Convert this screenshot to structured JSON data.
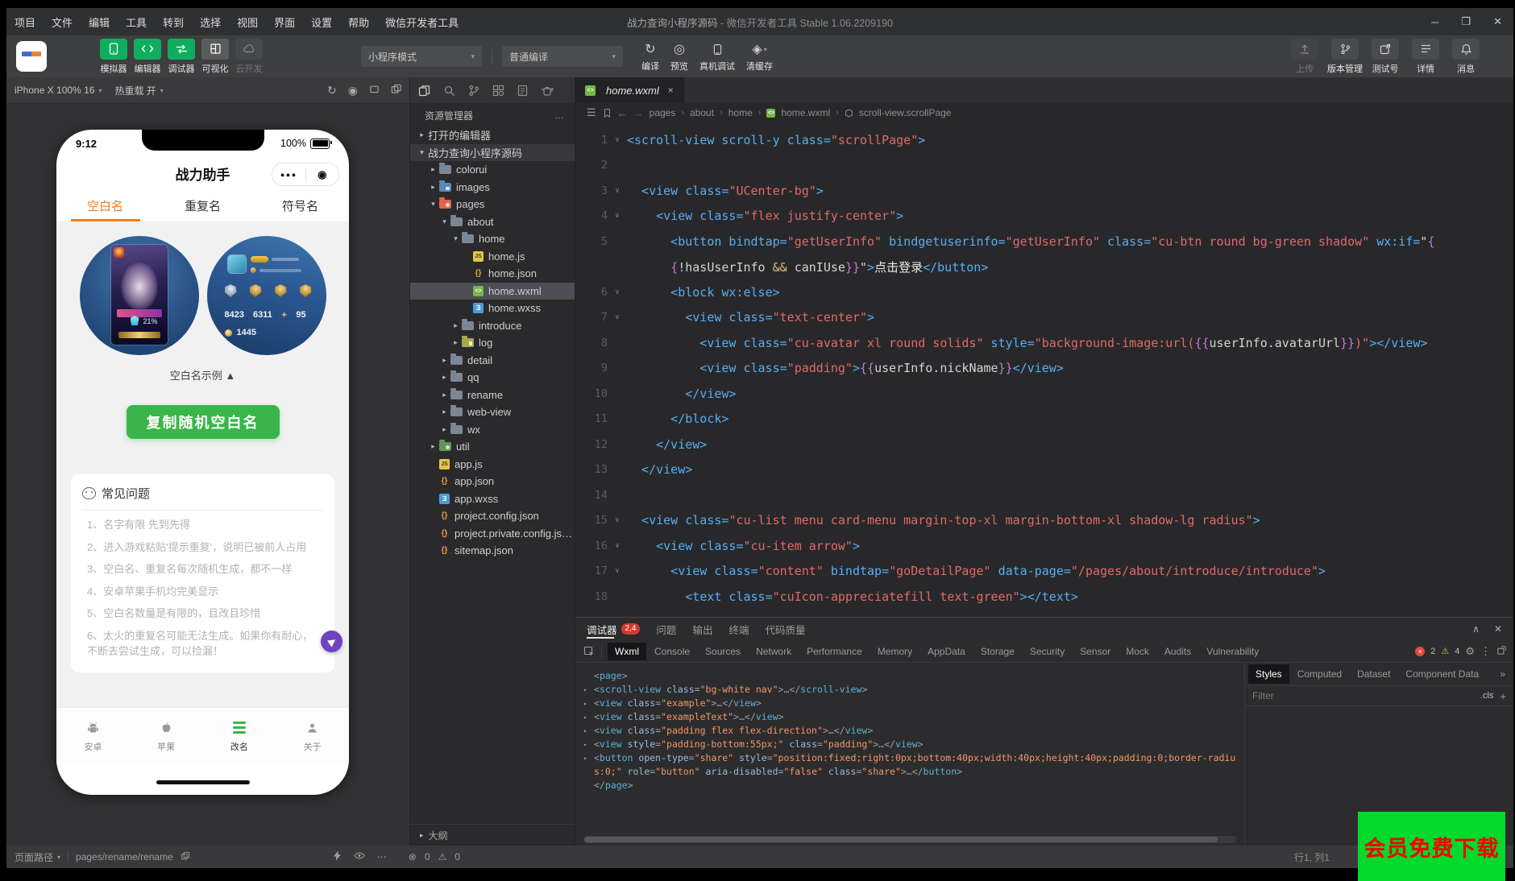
{
  "window": {
    "title_project": "战力查询小程序源码",
    "title_rest": " - 微信开发者工具 Stable 1.06.2209190"
  },
  "menu": {
    "items": [
      "项目",
      "文件",
      "编辑",
      "工具",
      "转到",
      "选择",
      "视图",
      "界面",
      "设置",
      "帮助",
      "微信开发者工具"
    ]
  },
  "toolbar": {
    "primary": [
      {
        "label": "模拟器",
        "icon": "simulator",
        "style": "green"
      },
      {
        "label": "编辑器",
        "icon": "editor",
        "style": "green"
      },
      {
        "label": "调试器",
        "icon": "debugger",
        "style": "green"
      },
      {
        "label": "可视化",
        "icon": "visual",
        "style": "gray"
      },
      {
        "label": "云开发",
        "icon": "cloud",
        "style": "disabled"
      }
    ],
    "mode_dropdown": "小程序模式",
    "compile_dropdown": "普通编译",
    "actions": [
      {
        "label": "编译",
        "icon": "compile"
      },
      {
        "label": "预览",
        "icon": "preview"
      },
      {
        "label": "真机调试",
        "icon": "remote-debug"
      },
      {
        "label": "清缓存",
        "icon": "clear-cache",
        "dropdown": true
      }
    ],
    "right": [
      {
        "label": "上传",
        "icon": "upload",
        "disabled": true
      },
      {
        "label": "版本管理",
        "icon": "version"
      },
      {
        "label": "测试号",
        "icon": "test-account"
      },
      {
        "label": "详情",
        "icon": "details"
      },
      {
        "label": "消息",
        "icon": "message"
      }
    ]
  },
  "simulator": {
    "device": "iPhone X 100% 16",
    "hot_reload": "热重载 开"
  },
  "phone": {
    "time": "9:12",
    "battery": "100%",
    "nav_title": "战力助手",
    "tabs": [
      {
        "label": "空白名",
        "active": true
      },
      {
        "label": "重复名",
        "active": false
      },
      {
        "label": "符号名",
        "active": false
      }
    ],
    "avatar_pct": "21%",
    "stats": [
      "8423",
      "6311",
      "95"
    ],
    "stat_extra": "1445",
    "caption": "空白名示例 ▲",
    "copy_button": "复制随机空白名",
    "faq_title": "常见问题",
    "faq_items": [
      "1、名字有限 先到先得",
      "2、进入游戏粘贴'提示重复'，说明已被前人占用",
      "3、空白名、重复名每次随机生成，都不一样",
      "4、安卓苹果手机均完美显示",
      "5、空白名数量是有限的，且改且珍惜",
      "6、太火的重复名可能无法生成。如果你有耐心，不断去尝试生成，可以捡漏！"
    ],
    "tabbar": [
      {
        "label": "安卓",
        "icon": "android",
        "active": false
      },
      {
        "label": "苹果",
        "icon": "apple",
        "active": false
      },
      {
        "label": "改名",
        "icon": "rename",
        "active": true
      },
      {
        "label": "关于",
        "icon": "about",
        "active": false
      }
    ]
  },
  "explorer": {
    "title": "资源管理器",
    "more": "…",
    "outline": "大纲",
    "tree": [
      {
        "t": "打开的编辑器",
        "d": 0,
        "a": "c"
      },
      {
        "t": "战力查询小程序源码",
        "d": 0,
        "a": "o",
        "row": "proj"
      },
      {
        "t": "colorui",
        "d": 1,
        "a": "c",
        "i": "folder"
      },
      {
        "t": "images",
        "d": 1,
        "a": "c",
        "i": "folder-img"
      },
      {
        "t": "pages",
        "d": 1,
        "a": "o",
        "i": "folder-pages"
      },
      {
        "t": "about",
        "d": 2,
        "a": "o",
        "i": "folder-open"
      },
      {
        "t": "home",
        "d": 3,
        "a": "o",
        "i": "folder-open"
      },
      {
        "t": "home.js",
        "d": 4,
        "i": "js"
      },
      {
        "t": "home.json",
        "d": 4,
        "i": "json"
      },
      {
        "t": "home.wxml",
        "d": 4,
        "i": "wxml",
        "row": "sel"
      },
      {
        "t": "home.wxss",
        "d": 4,
        "i": "wxss"
      },
      {
        "t": "introduce",
        "d": 3,
        "a": "c",
        "i": "folder"
      },
      {
        "t": "log",
        "d": 3,
        "a": "c",
        "i": "folder-log"
      },
      {
        "t": "detail",
        "d": 2,
        "a": "c",
        "i": "folder"
      },
      {
        "t": "qq",
        "d": 2,
        "a": "c",
        "i": "folder"
      },
      {
        "t": "rename",
        "d": 2,
        "a": "c",
        "i": "folder"
      },
      {
        "t": "web-view",
        "d": 2,
        "a": "c",
        "i": "folder"
      },
      {
        "t": "wx",
        "d": 2,
        "a": "c",
        "i": "folder"
      },
      {
        "t": "util",
        "d": 1,
        "a": "c",
        "i": "folder-util"
      },
      {
        "t": "app.js",
        "d": 1,
        "i": "js"
      },
      {
        "t": "app.json",
        "d": 1,
        "i": "json"
      },
      {
        "t": "app.wxss",
        "d": 1,
        "i": "wxss"
      },
      {
        "t": "project.config.json",
        "d": 1,
        "i": "json"
      },
      {
        "t": "project.private.config.js…",
        "d": 1,
        "i": "json"
      },
      {
        "t": "sitemap.json",
        "d": 1,
        "i": "json"
      }
    ]
  },
  "editor": {
    "tab": "home.wxml",
    "breadcrumb": [
      "pages",
      "about",
      "home",
      "home.wxml",
      "scroll-view.scrollPage"
    ],
    "code": [
      {
        "n": "1",
        "f": 1,
        "p": [
          [
            "tg",
            "<scroll-view scroll-y class="
          ],
          [
            "st",
            "\"scrollPage\""
          ],
          [
            "tg",
            ">"
          ]
        ]
      },
      {
        "n": "2",
        "p": []
      },
      {
        "n": "3",
        "f": 1,
        "p": [
          [
            "tg",
            "  <view class="
          ],
          [
            "st",
            "\"UCenter-bg\""
          ],
          [
            "tg",
            ">"
          ]
        ]
      },
      {
        "n": "4",
        "f": 1,
        "p": [
          [
            "tg",
            "    <view class="
          ],
          [
            "st",
            "\"flex justify-center\""
          ],
          [
            "tg",
            ">"
          ]
        ]
      },
      {
        "n": "5",
        "p": [
          [
            "tg",
            "      <button bindtap="
          ],
          [
            "st",
            "\"getUserInfo\""
          ],
          [
            "tg",
            " bindgetuserinfo="
          ],
          [
            "st",
            "\"getUserInfo\""
          ],
          [
            "tg",
            " class="
          ],
          [
            "st",
            "\"cu-btn round bg-green shadow\""
          ],
          [
            "tg",
            " wx:if="
          ],
          [
            "pl",
            "\""
          ],
          [
            "br",
            "{"
          ]
        ]
      },
      {
        "n": "",
        "p": [
          [
            "pl",
            "      "
          ],
          [
            "br",
            "{"
          ],
          [
            "pl",
            "!hasUserInfo "
          ],
          [
            "op",
            "&&"
          ],
          [
            "pl",
            " canIUse"
          ],
          [
            "br",
            "}}"
          ],
          [
            "pl",
            "\""
          ],
          [
            "tg",
            ">"
          ],
          [
            "ch",
            "点击登录"
          ],
          [
            "tg",
            "</button>"
          ]
        ]
      },
      {
        "n": "6",
        "f": 1,
        "p": [
          [
            "tg",
            "      <block wx:else>"
          ]
        ]
      },
      {
        "n": "7",
        "f": 1,
        "p": [
          [
            "tg",
            "        <view class="
          ],
          [
            "st",
            "\"text-center\""
          ],
          [
            "tg",
            ">"
          ]
        ]
      },
      {
        "n": "8",
        "p": [
          [
            "tg",
            "          <view class="
          ],
          [
            "st",
            "\"cu-avatar xl round solids\""
          ],
          [
            "tg",
            " style="
          ],
          [
            "st",
            "\"background-image:url("
          ],
          [
            "br",
            "{{"
          ],
          [
            "pl",
            "userInfo.avatarUrl"
          ],
          [
            "br",
            "}}"
          ],
          [
            "st",
            ")\""
          ],
          [
            "tg",
            "></view>"
          ]
        ]
      },
      {
        "n": "9",
        "p": [
          [
            "tg",
            "          <view class="
          ],
          [
            "st",
            "\"padding\""
          ],
          [
            "tg",
            ">"
          ],
          [
            "br",
            "{{"
          ],
          [
            "pl",
            "userInfo.nickName"
          ],
          [
            "br",
            "}}"
          ],
          [
            "tg",
            "</view>"
          ]
        ]
      },
      {
        "n": "10",
        "p": [
          [
            "tg",
            "        </view>"
          ]
        ]
      },
      {
        "n": "11",
        "p": [
          [
            "tg",
            "      </block>"
          ]
        ]
      },
      {
        "n": "12",
        "p": [
          [
            "tg",
            "    </view>"
          ]
        ]
      },
      {
        "n": "13",
        "p": [
          [
            "tg",
            "  </view>"
          ]
        ]
      },
      {
        "n": "14",
        "p": []
      },
      {
        "n": "15",
        "f": 1,
        "p": [
          [
            "tg",
            "  <view class="
          ],
          [
            "st",
            "\"cu-list menu card-menu margin-top-xl margin-bottom-xl shadow-lg radius\""
          ],
          [
            "tg",
            ">"
          ]
        ]
      },
      {
        "n": "16",
        "f": 1,
        "p": [
          [
            "tg",
            "    <view class="
          ],
          [
            "st",
            "\"cu-item arrow\""
          ],
          [
            "tg",
            ">"
          ]
        ]
      },
      {
        "n": "17",
        "f": 1,
        "p": [
          [
            "tg",
            "      <view class="
          ],
          [
            "st",
            "\"content\""
          ],
          [
            "tg",
            " bindtap="
          ],
          [
            "st",
            "\"goDetailPage\""
          ],
          [
            "tg",
            " data-page="
          ],
          [
            "st",
            "\"/pages/about/introduce/introduce\""
          ],
          [
            "tg",
            ">"
          ]
        ]
      },
      {
        "n": "18",
        "p": [
          [
            "tg",
            "        <text class="
          ],
          [
            "st",
            "\"cuIcon-appreciatefill text-green\""
          ],
          [
            "tg",
            "></text>"
          ]
        ]
      }
    ]
  },
  "debugger": {
    "panel_tabs": [
      "调试器",
      "问题",
      "输出",
      "终端",
      "代码质量"
    ],
    "badge": "2,4",
    "tabs": [
      "Wxml",
      "Console",
      "Sources",
      "Network",
      "Performance",
      "Memory",
      "AppData",
      "Storage",
      "Security",
      "Sensor",
      "Mock",
      "Audits",
      "Vulnerability"
    ],
    "active_tab": "Wxml",
    "error_count": "2",
    "warn_count": "4",
    "tree": [
      {
        "a": 0,
        "p": [
          [
            "pu",
            "<"
          ],
          [
            "tn",
            "page"
          ],
          [
            "pu",
            ">"
          ]
        ]
      },
      {
        "a": 1,
        "p": [
          [
            "pu",
            "<"
          ],
          [
            "tn",
            "scroll-view"
          ],
          [
            "an",
            " class"
          ],
          [
            "pu",
            "="
          ],
          [
            "av",
            "\"bg-white nav\""
          ],
          [
            "pu",
            ">"
          ],
          [
            "el",
            "…"
          ],
          [
            "pu",
            "</"
          ],
          [
            "tn",
            "scroll-view"
          ],
          [
            "pu",
            ">"
          ]
        ]
      },
      {
        "a": 1,
        "p": [
          [
            "pu",
            "<"
          ],
          [
            "tn",
            "view"
          ],
          [
            "an",
            " class"
          ],
          [
            "pu",
            "="
          ],
          [
            "av",
            "\"example\""
          ],
          [
            "pu",
            ">"
          ],
          [
            "el",
            "…"
          ],
          [
            "pu",
            "</"
          ],
          [
            "tn",
            "view"
          ],
          [
            "pu",
            ">"
          ]
        ]
      },
      {
        "a": 1,
        "p": [
          [
            "pu",
            "<"
          ],
          [
            "tn",
            "view"
          ],
          [
            "an",
            " class"
          ],
          [
            "pu",
            "="
          ],
          [
            "av",
            "\"exampleText\""
          ],
          [
            "pu",
            ">"
          ],
          [
            "el",
            "…"
          ],
          [
            "pu",
            "</"
          ],
          [
            "tn",
            "view"
          ],
          [
            "pu",
            ">"
          ]
        ]
      },
      {
        "a": 1,
        "p": [
          [
            "pu",
            "<"
          ],
          [
            "tn",
            "view"
          ],
          [
            "an",
            " class"
          ],
          [
            "pu",
            "="
          ],
          [
            "av",
            "\"padding flex flex-direction\""
          ],
          [
            "pu",
            ">"
          ],
          [
            "el",
            "…"
          ],
          [
            "pu",
            "</"
          ],
          [
            "tn",
            "view"
          ],
          [
            "pu",
            ">"
          ]
        ]
      },
      {
        "a": 1,
        "p": [
          [
            "pu",
            "<"
          ],
          [
            "tn",
            "view"
          ],
          [
            "an",
            " style"
          ],
          [
            "pu",
            "="
          ],
          [
            "av",
            "\"padding-bottom:55px;\""
          ],
          [
            "an",
            " class"
          ],
          [
            "pu",
            "="
          ],
          [
            "av",
            "\"padding\""
          ],
          [
            "pu",
            ">"
          ],
          [
            "el",
            "…"
          ],
          [
            "pu",
            "</"
          ],
          [
            "tn",
            "view"
          ],
          [
            "pu",
            ">"
          ]
        ]
      },
      {
        "a": 1,
        "p": [
          [
            "pu",
            "<"
          ],
          [
            "tn",
            "button"
          ],
          [
            "an",
            " open-type"
          ],
          [
            "pu",
            "="
          ],
          [
            "av",
            "\"share\""
          ],
          [
            "an",
            " style"
          ],
          [
            "pu",
            "="
          ],
          [
            "av",
            "\"position:fixed;right:0px;bottom:40px;width:40px;height:40px;padding:0;border-radius:0;\""
          ],
          [
            "an",
            " role"
          ],
          [
            "pu",
            "="
          ],
          [
            "av",
            "\"button\""
          ],
          [
            "an",
            " aria-disabled"
          ],
          [
            "pu",
            "="
          ],
          [
            "av",
            "\"false\""
          ],
          [
            "an",
            " class"
          ],
          [
            "pu",
            "="
          ],
          [
            "av",
            "\"share\""
          ],
          [
            "pu",
            ">"
          ],
          [
            "el",
            "…"
          ],
          [
            "pu",
            "</"
          ],
          [
            "tn",
            "button"
          ],
          [
            "pu",
            ">"
          ]
        ]
      },
      {
        "a": 0,
        "p": [
          [
            "pu",
            "</"
          ],
          [
            "tn",
            "page"
          ],
          [
            "pu",
            ">"
          ]
        ]
      }
    ],
    "right_tabs": [
      "Styles",
      "Computed",
      "Dataset",
      "Component Data"
    ],
    "filter": "Filter",
    "cls": ".cls"
  },
  "statusbar": {
    "path_label": "页面路径",
    "path": "pages/rename/rename",
    "errors": "0",
    "warnings": "0",
    "line_col": "行1, 列1"
  },
  "banner": "会员免费下载"
}
